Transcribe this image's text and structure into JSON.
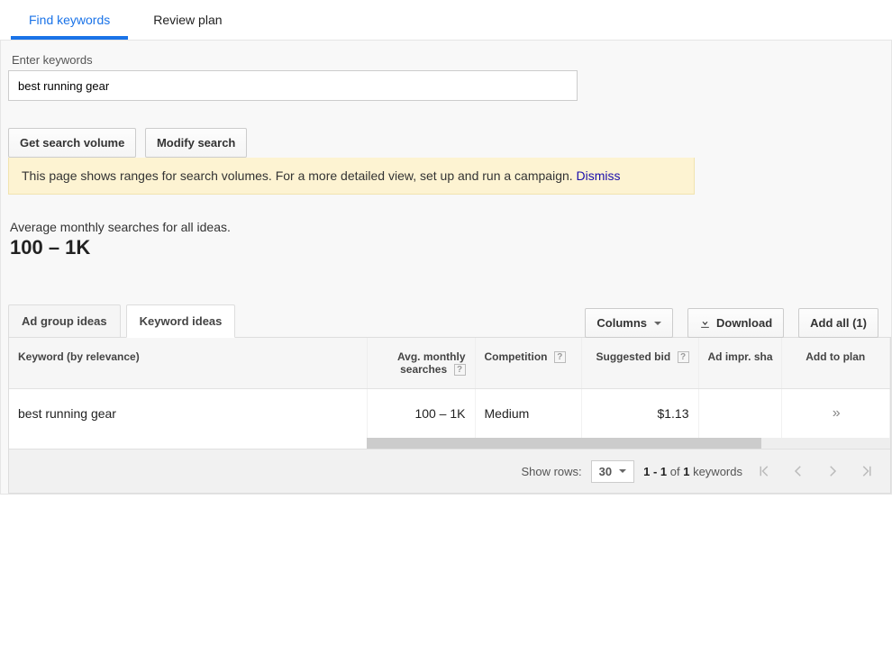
{
  "top_tabs": {
    "find": "Find keywords",
    "review": "Review plan"
  },
  "enter_label": "Enter keywords",
  "keyword_value": "best running gear",
  "buttons": {
    "get_volume": "Get search volume",
    "modify": "Modify search",
    "columns": "Columns",
    "download": "Download",
    "add_all": "Add all (1)"
  },
  "banner": {
    "text": "This page shows ranges for search volumes. For a more detailed view, set up and run a campaign. ",
    "dismiss": "Dismiss"
  },
  "avg": {
    "label": "Average monthly searches for all ideas.",
    "value": "100 – 1K"
  },
  "sub_tabs": {
    "ad_group": "Ad group ideas",
    "keyword": "Keyword ideas"
  },
  "table": {
    "headers": {
      "keyword": "Keyword (by relevance)",
      "avg": "Avg. monthly searches",
      "competition": "Competition",
      "bid": "Suggested bid",
      "impr": "Ad impr. sha",
      "add": "Add to plan"
    },
    "rows": [
      {
        "keyword": "best running gear",
        "avg": "100 – 1K",
        "competition": "Medium",
        "bid": "$1.13",
        "impr": ""
      }
    ]
  },
  "pager": {
    "show_rows": "Show rows:",
    "rows_value": "30",
    "range_a": "1 - 1",
    "of": " of ",
    "range_b": "1",
    "suffix": " keywords"
  }
}
